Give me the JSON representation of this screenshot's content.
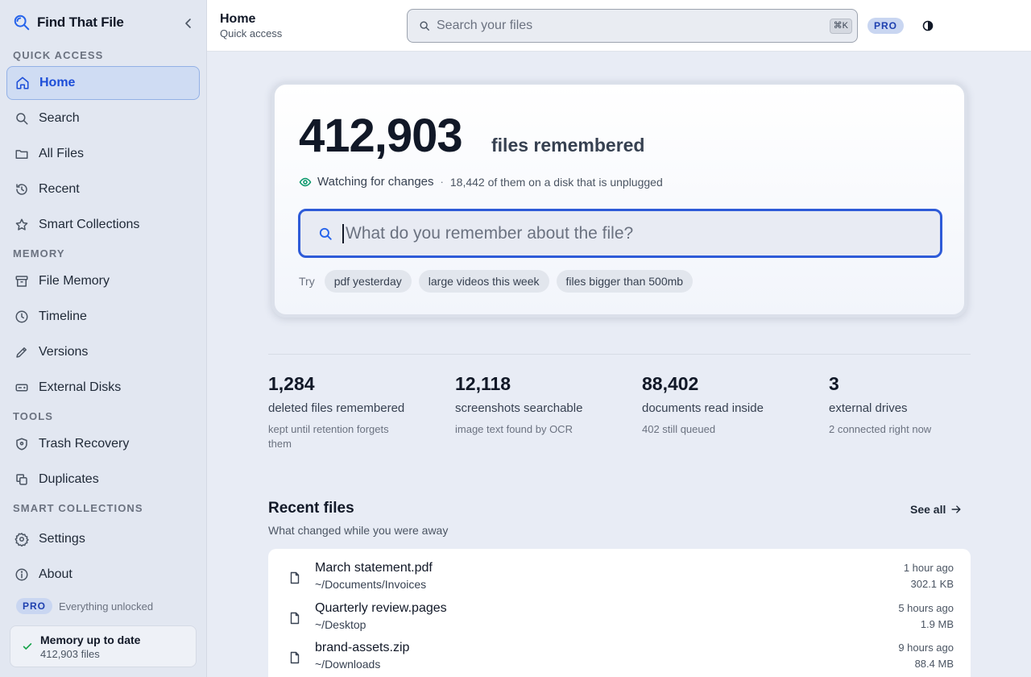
{
  "sidebar": {
    "brand": "Find That File",
    "sections": {
      "quick_access": "QUICK ACCESS",
      "memory": "MEMORY",
      "tools": "TOOLS",
      "smart_collections": "SMART COLLECTIONS"
    },
    "items": {
      "home": {
        "label": "Home",
        "icon": "home-icon"
      },
      "search": {
        "label": "Search",
        "icon": "search-icon"
      },
      "all_files": {
        "label": "All Files",
        "icon": "folder-icon"
      },
      "recent": {
        "label": "Recent",
        "icon": "history-icon"
      },
      "smart_collections": {
        "label": "Smart Collections",
        "icon": "star-icon"
      },
      "file_memory": {
        "label": "File Memory",
        "icon": "archive-icon"
      },
      "timeline": {
        "label": "Timeline",
        "icon": "clock-icon"
      },
      "versions": {
        "label": "Versions",
        "icon": "pencil-icon"
      },
      "external_disks": {
        "label": "External Disks",
        "icon": "drive-icon"
      },
      "trash_recovery": {
        "label": "Trash Recovery",
        "icon": "shield-icon"
      },
      "duplicates": {
        "label": "Duplicates",
        "icon": "copy-icon"
      },
      "settings": {
        "label": "Settings",
        "icon": "gear-icon"
      },
      "about": {
        "label": "About",
        "icon": "info-icon"
      }
    },
    "pro_badge": "PRO",
    "pro_text": "Everything unlocked",
    "status_title": "Memory up to date",
    "status_count": "412,903 files"
  },
  "topbar": {
    "title": "Home",
    "subtitle": "Quick access",
    "search_placeholder": "Search your files",
    "shortcut": "⌘K",
    "pro_badge": "PRO"
  },
  "hero": {
    "count": "412,903",
    "count_label": "files remembered",
    "watching": "Watching for changes",
    "separator": "·",
    "unplugged": "18,442 of them on a disk that is unplugged",
    "search_placeholder": "What do you remember about the file?",
    "try_label": "Try",
    "chips": [
      "pdf yesterday",
      "large videos this week",
      "files bigger than 500mb"
    ]
  },
  "stats": [
    {
      "value": "1,284",
      "label": "deleted files remembered",
      "sub": "kept until retention forgets them"
    },
    {
      "value": "12,118",
      "label": "screenshots searchable",
      "sub": "image text found by OCR"
    },
    {
      "value": "88,402",
      "label": "documents read inside",
      "sub": "402 still queued"
    },
    {
      "value": "3",
      "label": "external drives",
      "sub": "2 connected right now"
    }
  ],
  "recent_files": {
    "title": "Recent files",
    "subtitle": "What changed while you were away",
    "see_all": "See all",
    "files": [
      {
        "name": "March statement.pdf",
        "path": "~/Documents/Invoices",
        "time": "1 hour ago",
        "size": "302.1 KB"
      },
      {
        "name": "Quarterly review.pages",
        "path": "~/Desktop",
        "time": "5 hours ago",
        "size": "1.9 MB"
      },
      {
        "name": "brand-assets.zip",
        "path": "~/Downloads",
        "time": "9 hours ago",
        "size": "88.4 MB"
      }
    ]
  },
  "colors": {
    "accent": "#1d4ed8",
    "sidebar_bg": "#e2e7f1",
    "active_bg": "#cfdcf3",
    "status_ok": "#16a34a"
  }
}
